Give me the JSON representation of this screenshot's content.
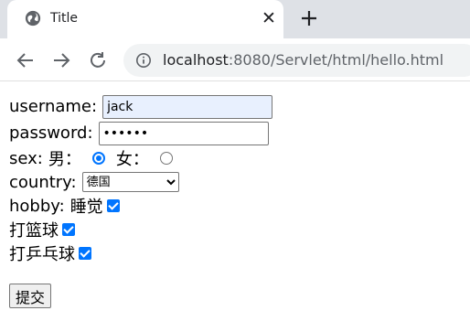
{
  "browser": {
    "tab": {
      "title": "Title",
      "favicon": "globe-icon",
      "close_icon": "close-icon"
    },
    "new_tab_icon": "plus-icon",
    "toolbar": {
      "back_icon": "back-arrow-icon",
      "forward_icon": "forward-arrow-icon",
      "reload_icon": "reload-icon",
      "info_icon": "info-icon",
      "url_host": "localhost",
      "url_rest": ":8080/Servlet/html/hello.html"
    }
  },
  "form": {
    "username_label": "username:",
    "username_value": "jack",
    "password_label": "password:",
    "password_value": "jackma",
    "sex_label": "sex:",
    "sex_male": "男：",
    "sex_female": "女：",
    "sex_selected": "男",
    "country_label": "country:",
    "country_selected": "德国",
    "hobby_label": "hobby:",
    "hobbies": [
      {
        "label": "睡觉",
        "checked": true
      },
      {
        "label": "打篮球",
        "checked": true
      },
      {
        "label": "打乒乓球",
        "checked": true
      }
    ],
    "submit_label": "提交"
  },
  "colors": {
    "accent": "#0075ff",
    "autofill_bg": "#e8f0fe",
    "tabstrip_bg": "#dee1e6",
    "omnibox_bg": "#f1f3f4"
  }
}
